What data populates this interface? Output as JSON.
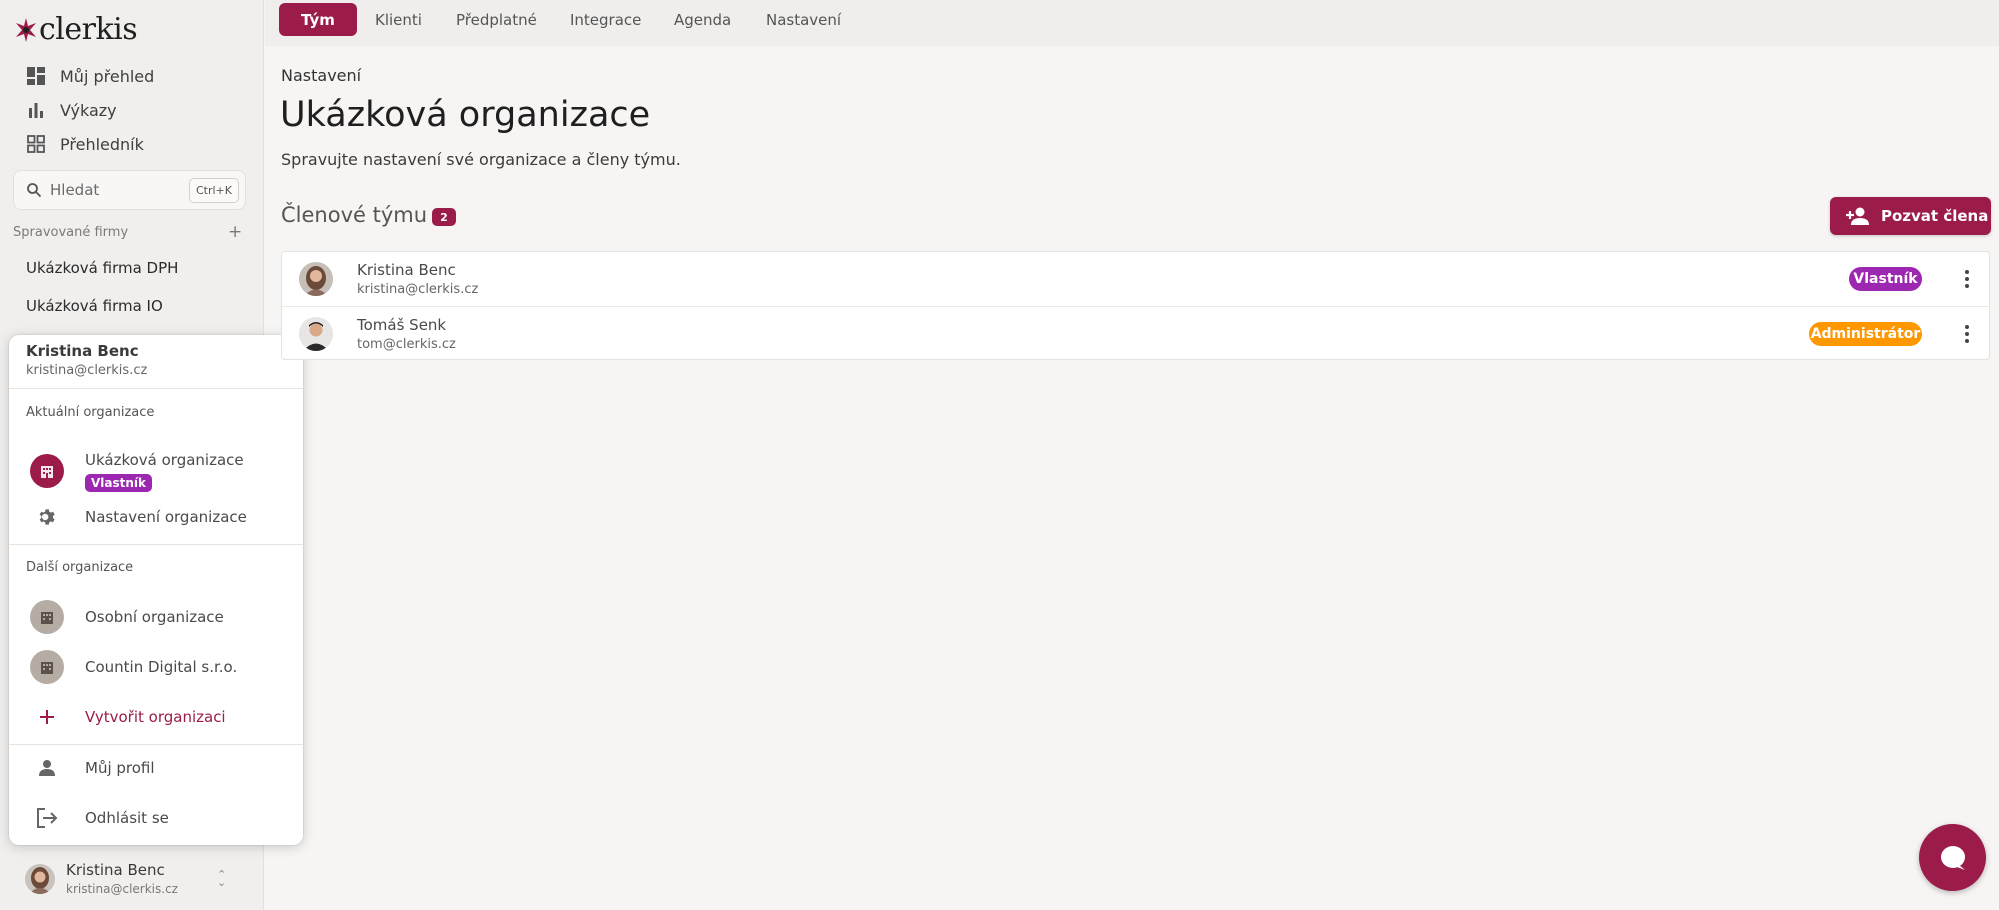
{
  "app": {
    "logo_text": "clerkis"
  },
  "sidebar": {
    "nav": [
      {
        "label": "Můj přehled",
        "icon": "dashboard-icon"
      },
      {
        "label": "Výkazy",
        "icon": "bar-chart-icon"
      },
      {
        "label": "Přehledník",
        "icon": "grid-icon"
      }
    ],
    "search": {
      "placeholder": "Hledat",
      "shortcut": "Ctrl+K"
    },
    "managed_label": "Spravované firmy",
    "firms": [
      "Ukázková firma DPH",
      "Ukázková firma IO"
    ],
    "bottom_user": {
      "name": "Kristina Benc",
      "email": "kristina@clerkis.cz"
    }
  },
  "menu": {
    "user_name": "Kristina Benc",
    "user_email": "kristina@clerkis.cz",
    "current_label": "Aktuální organizace",
    "current_org": {
      "name": "Ukázková organizace",
      "role": "Vlastník"
    },
    "org_settings": "Nastavení organizace",
    "other_label": "Další organizace",
    "other_orgs": [
      "Osobní organizace",
      "Countin Digital s.r.o."
    ],
    "create_org": "Vytvořit organizaci",
    "my_profile": "Můj profil",
    "logout": "Odhlásit se"
  },
  "tabs": [
    "Tým",
    "Klienti",
    "Předplatné",
    "Integrace",
    "Agenda",
    "Nastavení"
  ],
  "main": {
    "breadcrumb": "Nastavení",
    "title": "Ukázková organizace",
    "subtitle": "Spravujte nastavení své organizace a členy týmu.",
    "members_title": "Členové týmu",
    "members_count": "2",
    "invite_label": "Pozvat člena",
    "members": [
      {
        "name": "Kristina Benc",
        "email": "kristina@clerkis.cz",
        "role": "Vlastník",
        "role_color": "#9c27b0"
      },
      {
        "name": "Tomáš Senk",
        "email": "tom@clerkis.cz",
        "role": "Administrátor",
        "role_color": "#ff9800"
      }
    ]
  },
  "colors": {
    "brand": "#9b1b4a",
    "owner": "#9c27b0",
    "admin": "#ff9800"
  }
}
